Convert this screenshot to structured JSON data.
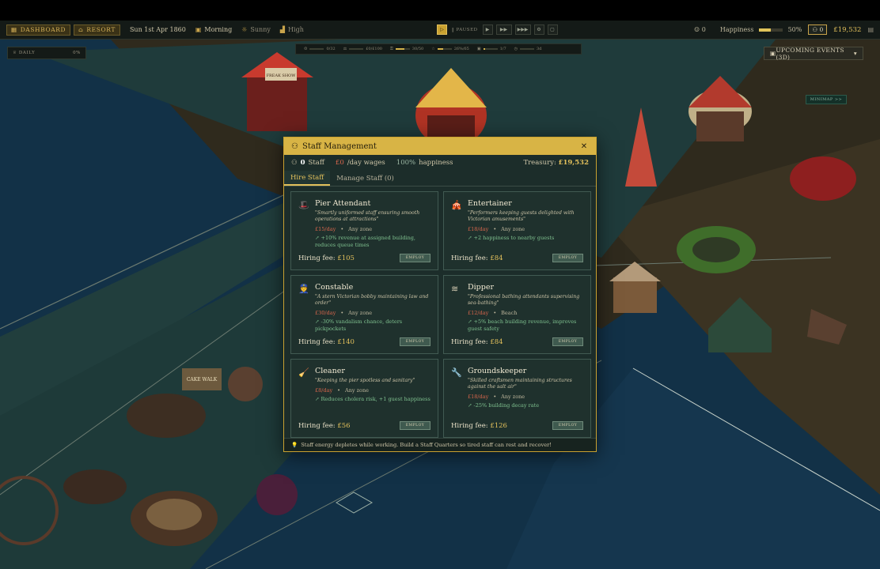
{
  "topbar": {
    "dashboard": "DASHBOARD",
    "resort": "RESORT",
    "date": "Sun 1st Apr 1860",
    "time_of_day": "Morning",
    "weather": "Sunny",
    "demand": "High",
    "paused": "PAUSED",
    "guests": "0",
    "happiness_label": "Happiness",
    "happiness_value": "50%",
    "happiness_level": 0.5,
    "staff_count_box": "0",
    "treasury": "£19,532"
  },
  "metrics": [
    {
      "value": "0/32",
      "level": 0.0
    },
    {
      "value": "£0/£100",
      "level": 0.0
    },
    {
      "value": "30/50",
      "level": 0.6
    },
    {
      "value": "26%/65",
      "level": 0.4
    },
    {
      "value": "1/7",
      "level": 0.15
    },
    {
      "value": "3d",
      "level": 0.0
    }
  ],
  "daily": {
    "label": "DAILY",
    "value": "0%"
  },
  "upcoming": {
    "label": "UPCOMING EVENTS (3D)"
  },
  "minimap": {
    "label": "MINIMAP >>"
  },
  "world_signs": {
    "freak_show": "FREAK SHOW",
    "cake_walk": "CAKE WALK"
  },
  "modal": {
    "title": "Staff Management",
    "staff_count": "0",
    "staff_label": "Staff",
    "wages_value": "£0",
    "wages_label": "/day wages",
    "happiness_value": "100%",
    "happiness_label": "happiness",
    "treasury_label": "Treasury:",
    "treasury_value": "£19,532",
    "tabs": [
      "Hire Staff",
      "Manage Staff (0)"
    ],
    "employ_label": "EMPLOY",
    "fee_label": "Hiring fee:",
    "footer": "Staff energy depletes while working. Build a Staff Quarters so tired staff can rest and recover!",
    "cards": [
      {
        "name": "Pier Attendant",
        "desc": "\"Smartly uniformed staff ensuring smooth operations at attractions\"",
        "rate": "£15/day",
        "zone": "Any zone",
        "effect": "+10% revenue at assigned building, reduces queue times",
        "fee": "£105",
        "icon": "top-hat-icon"
      },
      {
        "name": "Entertainer",
        "desc": "\"Performers keeping guests delighted with Victorian amusements\"",
        "rate": "£18/day",
        "zone": "Any zone",
        "effect": "+2 happiness to nearby guests",
        "fee": "£84",
        "icon": "circus-tent-icon"
      },
      {
        "name": "Constable",
        "desc": "\"A stern Victorian bobby maintaining law and order\"",
        "rate": "£30/day",
        "zone": "Any zone",
        "effect": "-30% vandalism chance, deters pickpockets",
        "fee": "£140",
        "icon": "police-icon"
      },
      {
        "name": "Dipper",
        "desc": "\"Professional bathing attendants supervising sea-bathing\"",
        "rate": "£12/day",
        "zone": "Beach",
        "effect": "+5% beach building revenue, improves guest safety",
        "fee": "£84",
        "icon": "wave-icon"
      },
      {
        "name": "Cleaner",
        "desc": "\"Keeping the pier spotless and sanitary\"",
        "rate": "£8/day",
        "zone": "Any zone",
        "effect": "Reduces cholera risk, +1 guest happiness",
        "fee": "£56",
        "icon": "broom-icon"
      },
      {
        "name": "Groundskeeper",
        "desc": "\"Skilled craftsmen maintaining structures against the salt air\"",
        "rate": "£18/day",
        "zone": "Any zone",
        "effect": "-25% building decay rate",
        "fee": "£126",
        "icon": "wrench-icon"
      }
    ]
  }
}
